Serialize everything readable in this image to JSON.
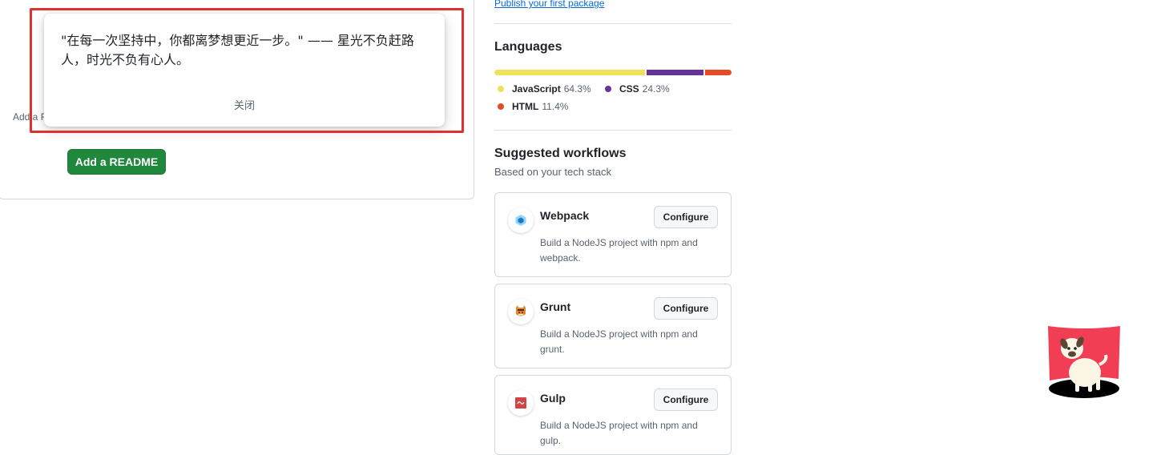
{
  "readme": {
    "hint": "Add a README",
    "button_label": "Add a README"
  },
  "popup": {
    "quote": "\"在每一次坚持中，你都离梦想更近一步。\" —— 星光不负赶路人，时光不负有心人。",
    "close_label": "关闭"
  },
  "sidebar": {
    "publish_link": "Publish your first package",
    "languages_title": "Languages",
    "languages": [
      {
        "name": "JavaScript",
        "percent": "64.3%",
        "color": "#f1e05a",
        "value": 64.3
      },
      {
        "name": "CSS",
        "percent": "24.3%",
        "color": "#663399",
        "value": 24.3
      },
      {
        "name": "HTML",
        "percent": "11.4%",
        "color": "#e34c26",
        "value": 11.4
      }
    ],
    "workflows_title": "Suggested workflows",
    "workflows_subtitle": "Based on your tech stack",
    "workflows": [
      {
        "name": "Webpack",
        "description": "Build a NodeJS project with npm and webpack.",
        "button": "Configure",
        "icon": "webpack-icon"
      },
      {
        "name": "Grunt",
        "description": "Build a NodeJS project with npm and grunt.",
        "button": "Configure",
        "icon": "grunt-icon"
      },
      {
        "name": "Gulp",
        "description": "Build a NodeJS project with npm and gulp.",
        "button": "Configure",
        "icon": "gulp-icon"
      }
    ]
  },
  "mascot": {
    "icon": "dog-mascot-icon",
    "accent": "#f23e55"
  }
}
